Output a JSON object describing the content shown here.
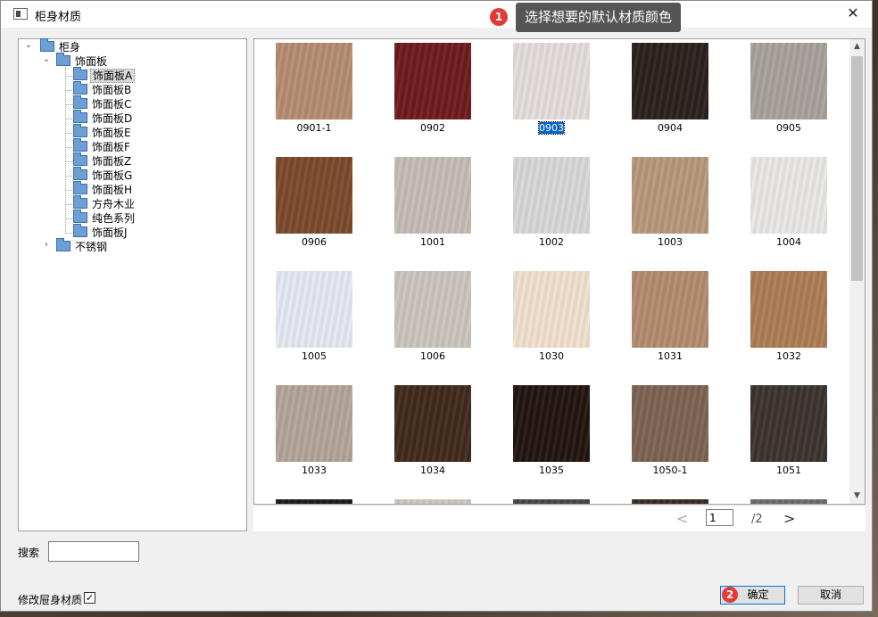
{
  "window": {
    "title": "柜身材质",
    "close": "✕"
  },
  "tooltip": {
    "badge": "1",
    "text": "选择想要的默认材质颜色"
  },
  "tree": {
    "root": "柜身",
    "group": "饰面板",
    "items": [
      "饰面板A",
      "饰面板B",
      "饰面板C",
      "饰面板D",
      "饰面板E",
      "饰面板F",
      "饰面板Z",
      "饰面板G",
      "饰面板H",
      "方舟木业",
      "纯色系列",
      "饰面板J"
    ],
    "selected": "饰面板A",
    "other": "不锈钢"
  },
  "materials": [
    {
      "code": "0901-1",
      "color": "#b58c72"
    },
    {
      "code": "0902",
      "color": "#6e1b1d"
    },
    {
      "code": "0903",
      "color": "#e4dedb",
      "selected": true
    },
    {
      "code": "0904",
      "color": "#2b211c"
    },
    {
      "code": "0905",
      "color": "#a8a29c"
    },
    {
      "code": "0906",
      "color": "#7b4a2b"
    },
    {
      "code": "1001",
      "color": "#c4bdb5"
    },
    {
      "code": "1002",
      "color": "#d8d8d8"
    },
    {
      "code": "1003",
      "color": "#b7997b"
    },
    {
      "code": "1004",
      "color": "#e9e8e6"
    },
    {
      "code": "1005",
      "color": "#e5e9f0"
    },
    {
      "code": "1006",
      "color": "#cac6bd"
    },
    {
      "code": "1030",
      "color": "#f1e0cf"
    },
    {
      "code": "1031",
      "color": "#b48c70"
    },
    {
      "code": "1032",
      "color": "#ad7d55"
    },
    {
      "code": "1033",
      "color": "#b3a498"
    },
    {
      "code": "1034",
      "color": "#412a1b"
    },
    {
      "code": "1035",
      "color": "#231510"
    },
    {
      "code": "1050-1",
      "color": "#7d6353"
    },
    {
      "code": "1051",
      "color": "#3c342e"
    },
    {
      "code": "",
      "color": "#1f1a1a"
    },
    {
      "code": "",
      "color": "#cfc7bd"
    },
    {
      "code": "",
      "color": "#4a4543"
    },
    {
      "code": "",
      "color": "#3a2a22"
    },
    {
      "code": "",
      "color": "#6f6a67"
    }
  ],
  "pager": {
    "prev": "<",
    "current": "1",
    "total": "/2",
    "next": ">"
  },
  "search": {
    "label": "搜索",
    "value": ""
  },
  "modify": {
    "label": "修改屉身材质",
    "checked": true,
    "mark": "☑"
  },
  "buttons": {
    "badge": "2",
    "ok": "确定",
    "cancel": "取消"
  }
}
